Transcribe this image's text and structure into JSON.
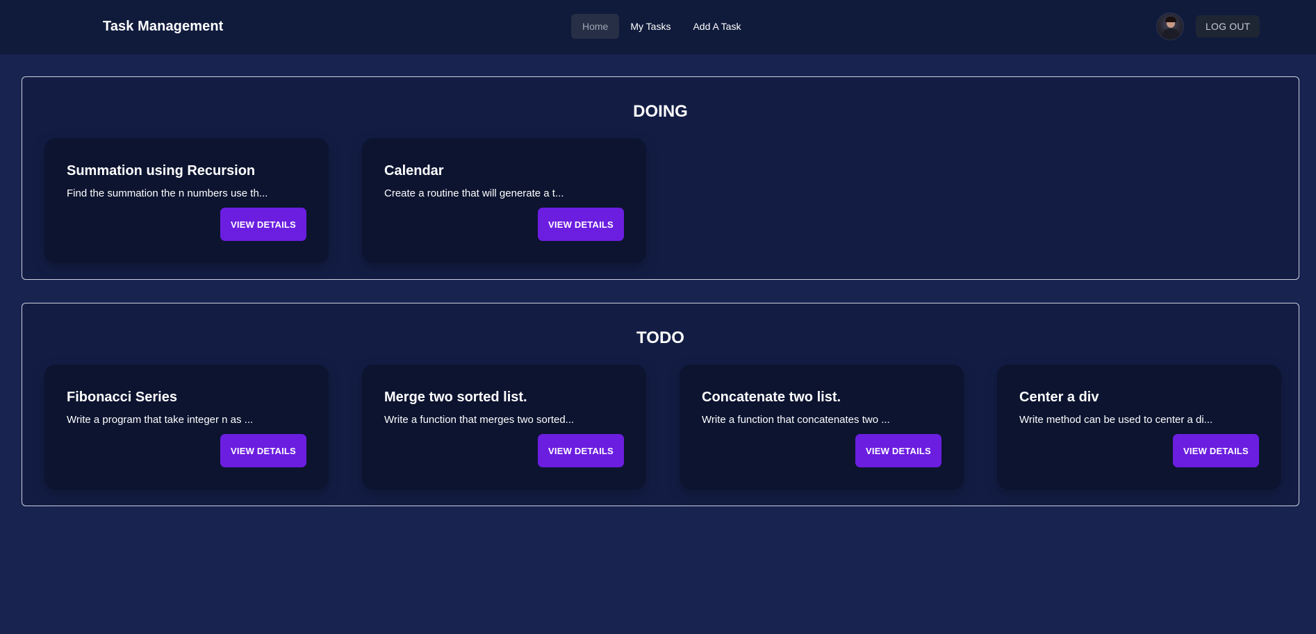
{
  "navbar": {
    "brand": "Task Management",
    "links": [
      {
        "label": "Home",
        "active": true
      },
      {
        "label": "My Tasks",
        "active": false
      },
      {
        "label": "Add A Task",
        "active": false
      }
    ],
    "logout_label": "LOG OUT"
  },
  "sections": [
    {
      "title": "DOING",
      "cards": [
        {
          "title": "Summation using Recursion",
          "description": "Find the summation the n numbers use th...",
          "button": "VIEW DETAILS"
        },
        {
          "title": "Calendar",
          "description": "Create a routine that will generate a t...",
          "button": "VIEW DETAILS"
        }
      ]
    },
    {
      "title": "TODO",
      "cards": [
        {
          "title": "Fibonacci Series",
          "description": "Write a program that take integer n as ...",
          "button": "VIEW DETAILS"
        },
        {
          "title": "Merge two sorted list.",
          "description": "Write a function that merges two sorted...",
          "button": "VIEW DETAILS"
        },
        {
          "title": "Concatenate two list.",
          "description": "Write a function that concatenates two ...",
          "button": "VIEW DETAILS"
        },
        {
          "title": "Center a div",
          "description": "Write method can be used to center a di...",
          "button": "VIEW DETAILS"
        }
      ]
    }
  ],
  "colors": {
    "background": "#18234f",
    "navbar": "#101b3c",
    "card": "#0c1430",
    "button": "#6b1ee0"
  }
}
